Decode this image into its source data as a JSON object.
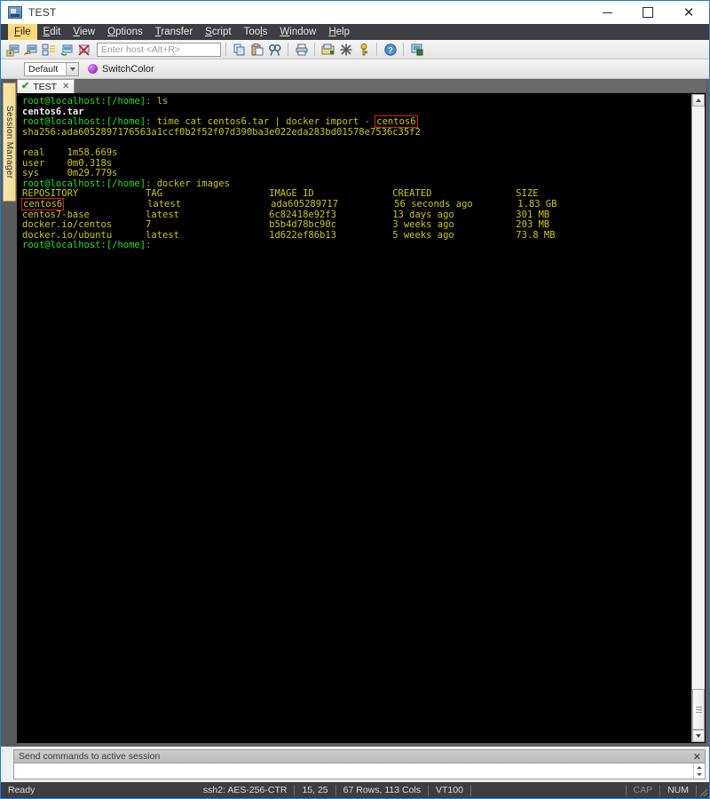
{
  "window": {
    "title": "TEST",
    "icon": "terminal-app-icon",
    "controls": {
      "minimize": "–",
      "maximize": "□",
      "close": "✕"
    }
  },
  "menubar": {
    "items": [
      {
        "label": "File",
        "accel": "F",
        "active": true
      },
      {
        "label": "Edit",
        "accel": "E",
        "active": false
      },
      {
        "label": "View",
        "accel": "V",
        "active": false
      },
      {
        "label": "Options",
        "accel": "O",
        "active": false
      },
      {
        "label": "Transfer",
        "accel": "T",
        "active": false
      },
      {
        "label": "Script",
        "accel": "S",
        "active": false
      },
      {
        "label": "Tools",
        "accel": "l",
        "active": false
      },
      {
        "label": "Window",
        "accel": "W",
        "active": false
      },
      {
        "label": "Help",
        "accel": "H",
        "active": false
      }
    ]
  },
  "toolbar": {
    "icons_left": [
      "new-session-icon",
      "quick-connect-icon",
      "session-manager-icon",
      "reconnect-icon",
      "disconnect-icon"
    ],
    "host_input": {
      "placeholder": "Enter host <Alt+R>",
      "value": ""
    },
    "icons_right": [
      "copy-icon",
      "paste-icon",
      "find-icon",
      "print-icon",
      "session-options-icon",
      "global-options-icon",
      "key-icon",
      "help-icon",
      "log-session-icon"
    ]
  },
  "profilebar": {
    "session_combo": "Default",
    "switch_color_label": "SwitchColor",
    "switch_color_dot": "#9b2fc9"
  },
  "sidebar": {
    "vertical_tab": "Session Manager"
  },
  "tabs": [
    {
      "label": "TEST",
      "status_icon": "connected-check-icon",
      "close_icon": "close-icon",
      "active": true
    }
  ],
  "terminal": {
    "colors": {
      "background": "#000000",
      "prompt": "#21e021",
      "text": "#c9c900",
      "bright": "#f2f2f2",
      "highlight_box": "#e01b1b"
    },
    "prompt": "root@localhost:[/home]:",
    "lines": [
      {
        "id": "l1",
        "type": "prompt-cmd",
        "prompt": "root@localhost:[/home]:",
        "command": " ls"
      },
      {
        "id": "l2",
        "type": "output-bright",
        "text": "centos6.tar"
      },
      {
        "id": "l3",
        "type": "prompt-cmd-boxed",
        "prompt": "root@localhost:[/home]:",
        "command": " time cat centos6.tar | docker import - ",
        "boxed": "centos6"
      },
      {
        "id": "l4",
        "type": "output",
        "text": "sha256:ada6052897176563a1ccf0b2f52f07d390ba3e022eda283bd01578e7536c35f2"
      },
      {
        "id": "l5",
        "type": "blank",
        "text": ""
      },
      {
        "id": "l6",
        "type": "output",
        "text": "real    1m58.669s"
      },
      {
        "id": "l7",
        "type": "output",
        "text": "user    0m0.318s"
      },
      {
        "id": "l8",
        "type": "output",
        "text": "sys     0m29.779s"
      },
      {
        "id": "l9",
        "type": "prompt-cmd",
        "prompt": "root@localhost:[/home]:",
        "command": " docker images"
      }
    ],
    "docker_images_table": {
      "headers": [
        "REPOSITORY",
        "TAG",
        "IMAGE ID",
        "CREATED",
        "SIZE"
      ],
      "rows": [
        {
          "repository": "centos6",
          "tag": "latest",
          "image_id": "ada605289717",
          "created": "56 seconds ago",
          "size": "1.83 GB",
          "highlight_repository": true
        },
        {
          "repository": "centos7-base",
          "tag": "latest",
          "image_id": "6c82418e92f3",
          "created": "13 days ago",
          "size": "301 MB",
          "highlight_repository": false
        },
        {
          "repository": "docker.io/centos",
          "tag": "7",
          "image_id": "b5b4d78bc90c",
          "created": "3 weeks ago",
          "size": "203 MB",
          "highlight_repository": false
        },
        {
          "repository": "docker.io/ubuntu",
          "tag": "latest",
          "image_id": "1d622ef86b13",
          "created": "5 weeks ago",
          "size": "73.8 MB",
          "highlight_repository": false
        }
      ]
    },
    "final_prompt": "root@localhost:[/home]:"
  },
  "send_commands": {
    "header": "Send commands to active session",
    "close_icon": "close-icon",
    "input_value": ""
  },
  "statusbar": {
    "ready": "Ready",
    "protocol": "ssh2: AES-256-CTR",
    "cursor": "15,  25",
    "dimensions": "67 Rows, 113 Cols",
    "emulation": "VT100",
    "cap": "CAP",
    "num": "NUM"
  }
}
